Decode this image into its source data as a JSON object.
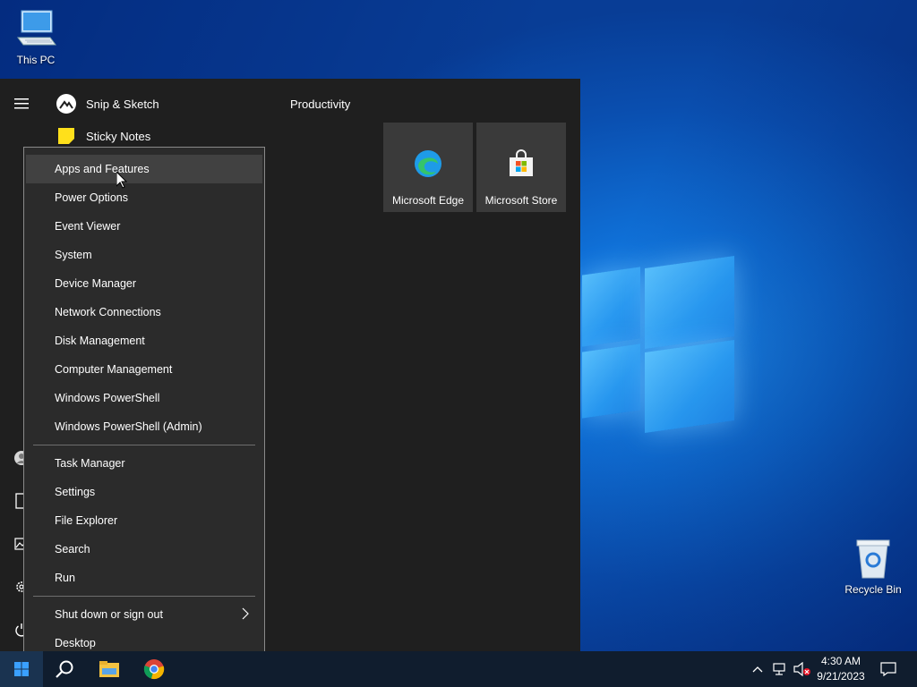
{
  "desktop": {
    "icons": [
      {
        "label": "This PC",
        "icon": "this-pc-icon"
      },
      {
        "label": "Recycle Bin",
        "icon": "recycle-bin-icon"
      }
    ]
  },
  "start_menu": {
    "apps": [
      {
        "label": "Snip & Sketch",
        "icon": "snip-sketch-icon"
      },
      {
        "label": "Sticky Notes",
        "icon": "sticky-notes-icon"
      }
    ],
    "group_title": "Productivity",
    "tiles": [
      {
        "label": "Microsoft Edge",
        "icon": "edge-icon"
      },
      {
        "label": "Microsoft Store",
        "icon": "store-icon"
      }
    ]
  },
  "context_menu": {
    "items": [
      "Apps and Features",
      "Power Options",
      "Event Viewer",
      "System",
      "Device Manager",
      "Network Connections",
      "Disk Management",
      "Computer Management",
      "Windows PowerShell",
      "Windows PowerShell (Admin)",
      "Task Manager",
      "Settings",
      "File Explorer",
      "Search",
      "Run",
      "Shut down or sign out",
      "Desktop"
    ],
    "hovered": "Apps and Features"
  },
  "taskbar": {
    "pinned": [
      "start-icon",
      "search-icon",
      "file-explorer-icon",
      "chrome-icon"
    ],
    "clock": {
      "time": "4:30 AM",
      "date": "9/21/2023"
    }
  },
  "colors": {
    "start_bg": "#1f1f1f",
    "menu_bg": "#2b2b2b",
    "taskbar_bg": "#101d2e",
    "accent": "#0078d7"
  }
}
